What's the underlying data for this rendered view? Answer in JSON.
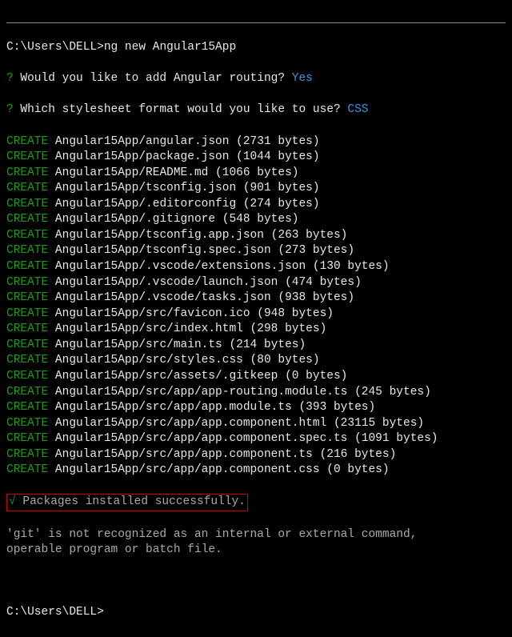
{
  "prompt1": {
    "path": "C:\\Users\\DELL>",
    "command": "ng new Angular15App"
  },
  "questions": [
    {
      "prefix": "?",
      "text": " Would you like to add Angular routing? ",
      "answer": "Yes"
    },
    {
      "prefix": "?",
      "text": " Which stylesheet format would you like to use? ",
      "answer": "CSS"
    }
  ],
  "creates": [
    {
      "label": "CREATE",
      "path": " Angular15App/angular.json (2731 bytes)"
    },
    {
      "label": "CREATE",
      "path": " Angular15App/package.json (1044 bytes)"
    },
    {
      "label": "CREATE",
      "path": " Angular15App/README.md (1066 bytes)"
    },
    {
      "label": "CREATE",
      "path": " Angular15App/tsconfig.json (901 bytes)"
    },
    {
      "label": "CREATE",
      "path": " Angular15App/.editorconfig (274 bytes)"
    },
    {
      "label": "CREATE",
      "path": " Angular15App/.gitignore (548 bytes)"
    },
    {
      "label": "CREATE",
      "path": " Angular15App/tsconfig.app.json (263 bytes)"
    },
    {
      "label": "CREATE",
      "path": " Angular15App/tsconfig.spec.json (273 bytes)"
    },
    {
      "label": "CREATE",
      "path": " Angular15App/.vscode/extensions.json (130 bytes)"
    },
    {
      "label": "CREATE",
      "path": " Angular15App/.vscode/launch.json (474 bytes)"
    },
    {
      "label": "CREATE",
      "path": " Angular15App/.vscode/tasks.json (938 bytes)"
    },
    {
      "label": "CREATE",
      "path": " Angular15App/src/favicon.ico (948 bytes)"
    },
    {
      "label": "CREATE",
      "path": " Angular15App/src/index.html (298 bytes)"
    },
    {
      "label": "CREATE",
      "path": " Angular15App/src/main.ts (214 bytes)"
    },
    {
      "label": "CREATE",
      "path": " Angular15App/src/styles.css (80 bytes)"
    },
    {
      "label": "CREATE",
      "path": " Angular15App/src/assets/.gitkeep (0 bytes)"
    },
    {
      "label": "CREATE",
      "path": " Angular15App/src/app/app-routing.module.ts (245 bytes)"
    },
    {
      "label": "CREATE",
      "path": " Angular15App/src/app/app.module.ts (393 bytes)"
    },
    {
      "label": "CREATE",
      "path": " Angular15App/src/app/app.component.html (23115 bytes)"
    },
    {
      "label": "CREATE",
      "path": " Angular15App/src/app/app.component.spec.ts (1091 bytes)"
    },
    {
      "label": "CREATE",
      "path": " Angular15App/src/app/app.component.ts (216 bytes)"
    },
    {
      "label": "CREATE",
      "path": " Angular15App/src/app/app.component.css (0 bytes)"
    }
  ],
  "success": {
    "check": "√",
    "message": " Packages installed successfully."
  },
  "error": "'git' is not recognized as an internal or external command,\noperable program or batch file.",
  "prompt2": "C:\\Users\\DELL>"
}
